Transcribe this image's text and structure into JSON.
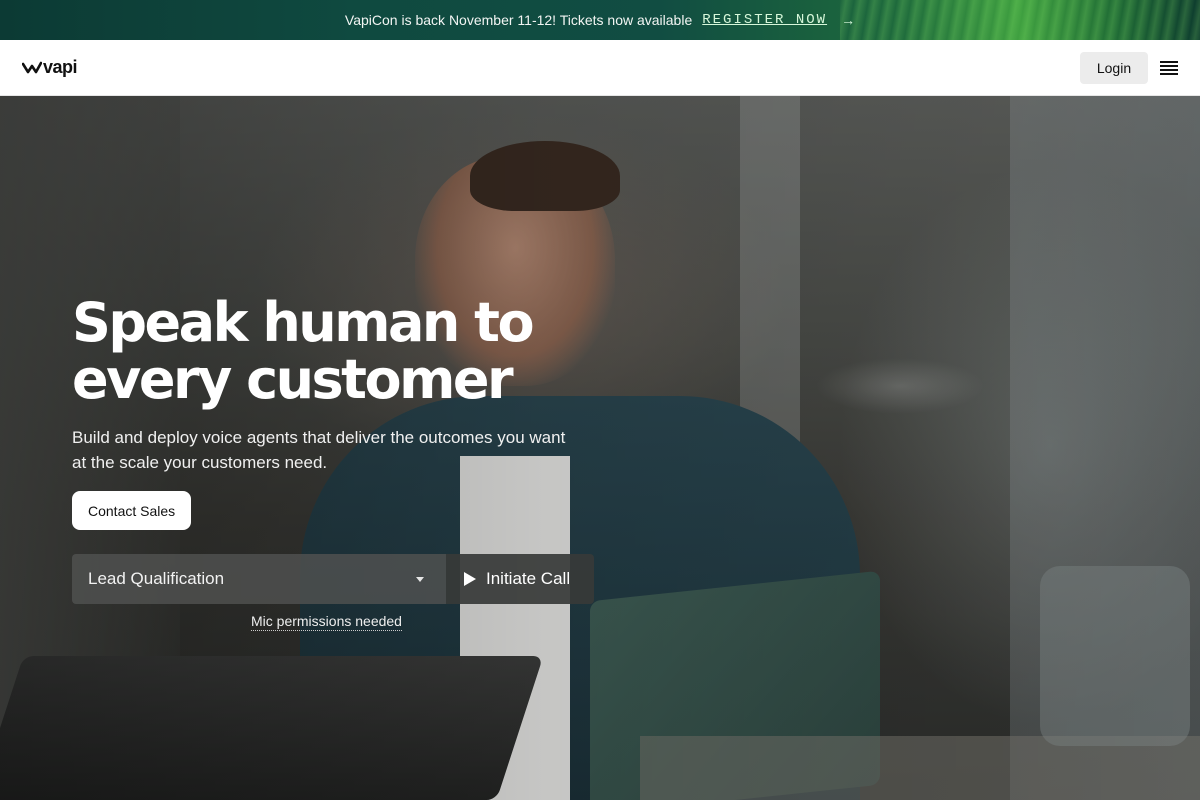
{
  "banner": {
    "text": "VapiCon is back November 11-12! Tickets now available",
    "link_label": "REGISTER NOW",
    "arrow": "→"
  },
  "nav": {
    "logo_text": "vapi",
    "login_label": "Login",
    "menu_icon": "hamburger-menu-icon"
  },
  "hero": {
    "title_line1": "Speak human to",
    "title_line2": "every customer",
    "subtitle": "Build and deploy voice agents that deliver the outcomes you want at the scale your customers need.",
    "contact_label": "Contact Sales",
    "select_value": "Lead Qualification",
    "call_label": "Initiate Call",
    "mic_note": "Mic permissions needed"
  },
  "colors": {
    "banner_bg": "#0f4a40",
    "nav_bg": "#ffffff",
    "login_bg": "#ececec",
    "primary_text": "#ffffff"
  }
}
